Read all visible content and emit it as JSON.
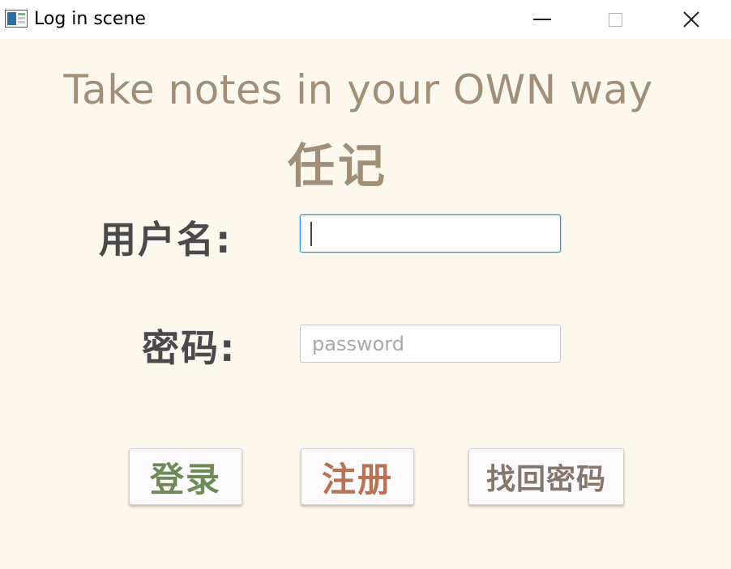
{
  "window": {
    "title": "Log in scene",
    "icon": "notes-app-icon",
    "controls": {
      "minimize": "minimize-icon",
      "maximize": "maximize-icon",
      "close": "close-icon"
    }
  },
  "header": {
    "slogan": "Take notes in your OWN way",
    "app_name": "任记"
  },
  "form": {
    "username_label": "用户名:",
    "username_value": "",
    "password_label": "密码:",
    "password_placeholder": "password"
  },
  "buttons": {
    "login": "登录",
    "register": "注册",
    "recover": "找回密码"
  },
  "colors": {
    "background": "#fdf8ee",
    "slogan": "#a09079",
    "label": "#4a4a4a",
    "login": "#6f8a58",
    "register": "#b87356",
    "recover": "#84766a",
    "focus_border": "#1e9ad6"
  }
}
